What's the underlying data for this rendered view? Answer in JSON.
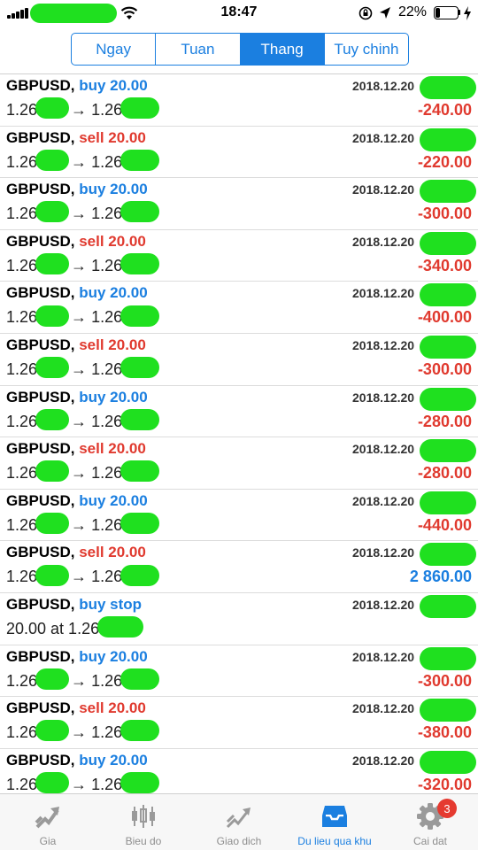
{
  "status_bar": {
    "time": "18:47",
    "battery_percent": "22%",
    "battery_level": 0.22,
    "icons": [
      "cellular-signal-icon",
      "wifi-icon",
      "orientation-lock-icon",
      "location-arrow-icon",
      "battery-icon",
      "charging-bolt-icon"
    ]
  },
  "period_tabs": [
    {
      "label": "Ngay",
      "active": false
    },
    {
      "label": "Tuan",
      "active": false
    },
    {
      "label": "Thang",
      "active": true
    },
    {
      "label": "Tuy chinh",
      "active": false
    }
  ],
  "colors": {
    "accent": "#1b7fe0",
    "loss": "#e03a2f",
    "redaction": "#1fe01f"
  },
  "trades": [
    {
      "symbol": "GBPUSD,",
      "type": "buy 20.00",
      "side": "buy",
      "open": "1.26",
      "arrow": "→",
      "close": "1.26",
      "date": "2018.12.20",
      "profit": "-240.00",
      "profit_sign": "neg"
    },
    {
      "symbol": "GBPUSD,",
      "type": "sell 20.00",
      "side": "sell",
      "open": "1.26",
      "arrow": "→",
      "close": "1.26",
      "date": "2018.12.20",
      "profit": "-220.00",
      "profit_sign": "neg"
    },
    {
      "symbol": "GBPUSD,",
      "type": "buy 20.00",
      "side": "buy",
      "open": "1.26",
      "arrow": "→",
      "close": "1.26",
      "date": "2018.12.20",
      "profit": "-300.00",
      "profit_sign": "neg"
    },
    {
      "symbol": "GBPUSD,",
      "type": "sell 20.00",
      "side": "sell",
      "open": "1.26",
      "arrow": "→",
      "close": "1.26",
      "date": "2018.12.20",
      "profit": "-340.00",
      "profit_sign": "neg"
    },
    {
      "symbol": "GBPUSD,",
      "type": "buy 20.00",
      "side": "buy",
      "open": "1.26",
      "arrow": "→",
      "close": "1.26",
      "date": "2018.12.20",
      "profit": "-400.00",
      "profit_sign": "neg"
    },
    {
      "symbol": "GBPUSD,",
      "type": "sell 20.00",
      "side": "sell",
      "open": "1.26",
      "arrow": "→",
      "close": "1.26",
      "date": "2018.12.20",
      "profit": "-300.00",
      "profit_sign": "neg"
    },
    {
      "symbol": "GBPUSD,",
      "type": "buy 20.00",
      "side": "buy",
      "open": "1.26",
      "arrow": "→",
      "close": "1.26",
      "date": "2018.12.20",
      "profit": "-280.00",
      "profit_sign": "neg"
    },
    {
      "symbol": "GBPUSD,",
      "type": "sell 20.00",
      "side": "sell",
      "open": "1.26",
      "arrow": "→",
      "close": "1.26",
      "date": "2018.12.20",
      "profit": "-280.00",
      "profit_sign": "neg"
    },
    {
      "symbol": "GBPUSD,",
      "type": "buy 20.00",
      "side": "buy",
      "open": "1.26",
      "arrow": "→",
      "close": "1.26",
      "date": "2018.12.20",
      "profit": "-440.00",
      "profit_sign": "neg"
    },
    {
      "symbol": "GBPUSD,",
      "type": "sell 20.00",
      "side": "sell",
      "open": "1.26",
      "arrow": "→",
      "close": "1.26",
      "date": "2018.12.20",
      "profit": "2 860.00",
      "profit_sign": "pos"
    },
    {
      "symbol": "GBPUSD,",
      "type": "buy stop",
      "side": "buy",
      "order_text": "20.00 at 1.26",
      "date": "2018.12.20",
      "profit": "",
      "profit_sign": "none"
    },
    {
      "symbol": "GBPUSD,",
      "type": "buy 20.00",
      "side": "buy",
      "open": "1.26",
      "arrow": "→",
      "close": "1.26",
      "date": "2018.12.20",
      "profit": "-300.00",
      "profit_sign": "neg"
    },
    {
      "symbol": "GBPUSD,",
      "type": "sell 20.00",
      "side": "sell",
      "open": "1.26",
      "arrow": "→",
      "close": "1.26",
      "date": "2018.12.20",
      "profit": "-380.00",
      "profit_sign": "neg"
    },
    {
      "symbol": "GBPUSD,",
      "type": "buy 20.00",
      "side": "buy",
      "open": "1.26",
      "arrow": "→",
      "close": "1.26",
      "date": "2018.12.20",
      "profit": "-320.00",
      "profit_sign": "neg"
    }
  ],
  "tab_bar": [
    {
      "label": "Gia",
      "icon": "trend-arrow-icon",
      "active": false
    },
    {
      "label": "Bieu do",
      "icon": "candlestick-icon",
      "active": false
    },
    {
      "label": "Giao dich",
      "icon": "trade-chart-icon",
      "active": false
    },
    {
      "label": "Du lieu qua khu",
      "icon": "history-inbox-icon",
      "active": true
    },
    {
      "label": "Cai dat",
      "icon": "gear-icon",
      "active": false,
      "badge": "3"
    }
  ]
}
